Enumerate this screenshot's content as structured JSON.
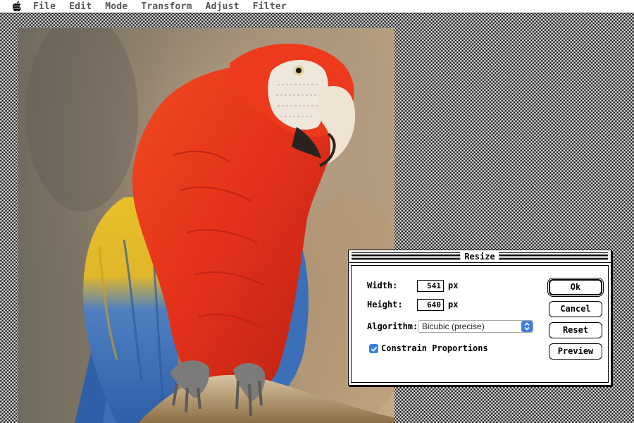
{
  "menubar": {
    "apple_icon": "apple-icon",
    "items": [
      {
        "label": "File"
      },
      {
        "label": "Edit"
      },
      {
        "label": "Mode"
      },
      {
        "label": "Transform"
      },
      {
        "label": "Adjust"
      },
      {
        "label": "Filter"
      }
    ]
  },
  "canvas": {
    "image_subject": "scarlet macaw parrot"
  },
  "dialog": {
    "title": "Resize",
    "width_label": "Width:",
    "width_value": "541",
    "width_unit": "px",
    "height_label": "Height:",
    "height_value": "640",
    "height_unit": "px",
    "algorithm_label": "Algorithm:",
    "algorithm_value": "Bicubic (precise)",
    "constrain_label": "Constrain Proportions",
    "constrain_checked": true,
    "buttons": {
      "ok": "Ok",
      "cancel": "Cancel",
      "reset": "Reset",
      "preview": "Preview"
    }
  },
  "colors": {
    "accent": "#3a7fe0",
    "parrot_red": "#e8321c",
    "wing_blue": "#3d6fb8",
    "wing_yellow": "#e8c02a"
  }
}
